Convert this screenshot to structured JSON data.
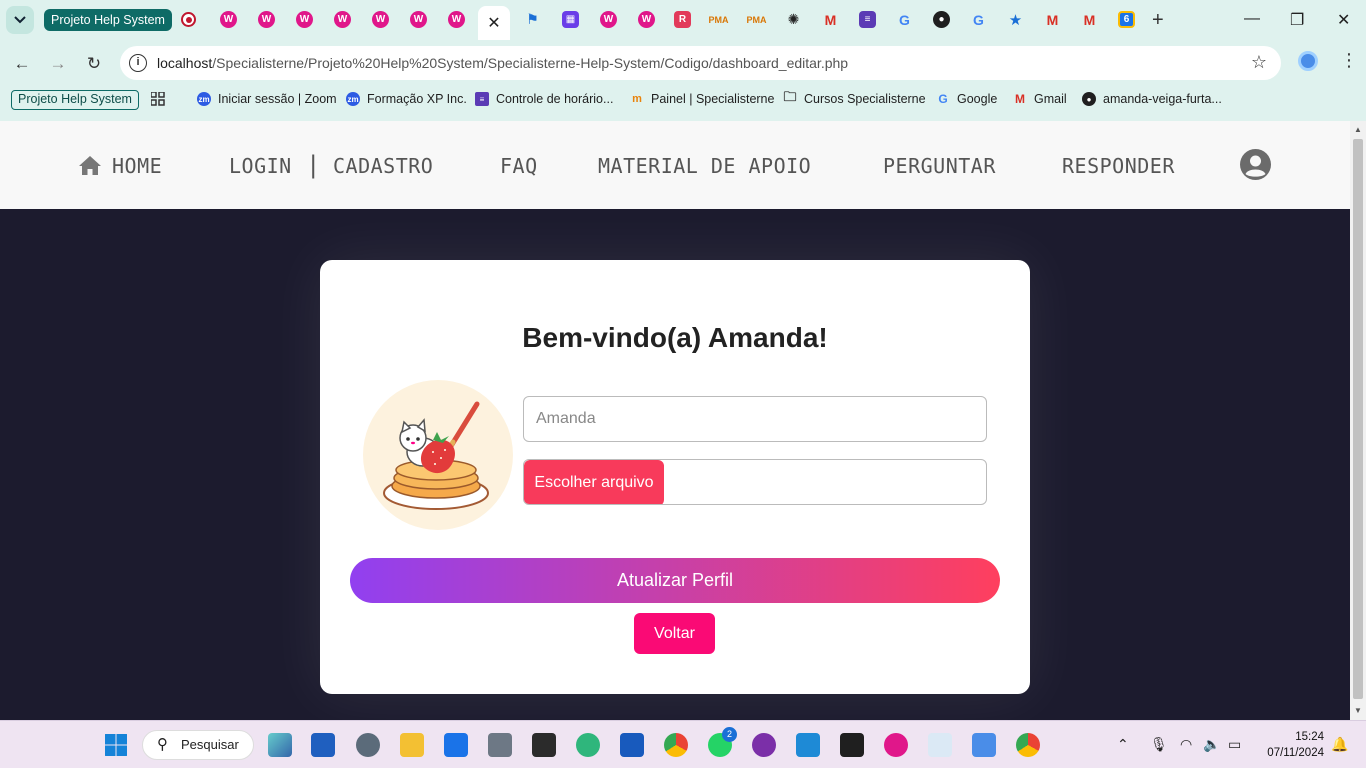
{
  "browser": {
    "tab_group_label": "Projeto Help System",
    "active_tab_close": "✕",
    "new_tab": "+",
    "address": {
      "host": "localhost",
      "path": "/Specialisterne/Projeto%20Help%20System/Specialisterne-Help-System/Codigo/dashboard_editar.php"
    },
    "bookmarks": [
      {
        "label": "Projeto Help System",
        "icon": "group-chip"
      },
      {
        "label": "Iniciar sessão | Zoom",
        "icon": "zoom-icon"
      },
      {
        "label": "Formação XP Inc.",
        "icon": "zoom-icon"
      },
      {
        "label": "Controle de horário...",
        "icon": "list-icon"
      },
      {
        "label": "Painel | Specialisterne",
        "icon": "moodle-icon"
      },
      {
        "label": "Cursos Specialisterne",
        "icon": "folder-icon"
      },
      {
        "label": "Google",
        "icon": "google-icon"
      },
      {
        "label": "Gmail",
        "icon": "gmail-icon"
      },
      {
        "label": "amanda-veiga-furta...",
        "icon": "github-icon"
      }
    ],
    "colors": {
      "chrome_bg": "#dff2ee",
      "tab_group": "#0e6b66"
    }
  },
  "site_nav": {
    "items": [
      "HOME",
      "LOGIN",
      "CADASTRO",
      "FAQ",
      "MATERIAL DE APOIO",
      "PERGUNTAR",
      "RESPONDER"
    ],
    "separator": "|"
  },
  "profile_card": {
    "welcome": "Bem-vindo(a) Amanda!",
    "name_placeholder": "Amanda",
    "file_button": "Escolher arquivo",
    "update_button": "Atualizar Perfil",
    "back_button": "Voltar",
    "colors": {
      "gradient_start": "#9140f0",
      "gradient_end": "#ff3f5e",
      "back": "#fa0a75",
      "file": "#f83a5b",
      "page_bg": "#1c1b2e"
    }
  },
  "taskbar": {
    "search_label": "Pesquisar",
    "whatsapp_badge": "2",
    "time": "15:24",
    "date": "07/11/2024"
  }
}
